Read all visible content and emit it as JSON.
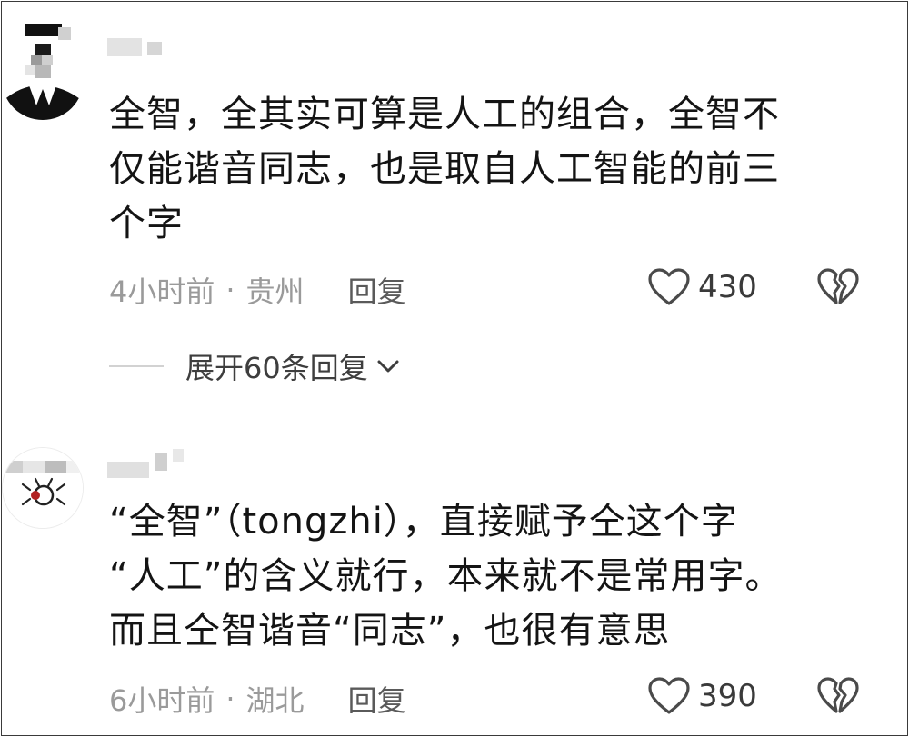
{
  "comments": [
    {
      "text_lines": [
        "全智，全其实可算是人工的组合，全智不",
        "仅能谐音同志，也是取自人工智能的前三",
        "个字"
      ],
      "time": "4小时前",
      "separator": "·",
      "location": "贵州",
      "reply_label": "回复",
      "like_count": "430",
      "expand_replies_label": "展开60条回复"
    },
    {
      "text_lines": [
        "“全智”（tongzhi），直接赋予仝这个字",
        "“人工”的含义就行，本来就不是常用字。",
        "而且仝智谐音“同志”，也很有意思"
      ],
      "time": "6小时前",
      "separator": "·",
      "location": "湖北",
      "reply_label": "回复",
      "like_count": "390"
    }
  ],
  "icons": {
    "like": "heart-outline-icon",
    "dislike": "broken-heart-icon",
    "expand": "chevron-down-icon"
  },
  "colors": {
    "text": "#141414",
    "meta": "#9a9a9a",
    "border": "#3a3a3a"
  }
}
